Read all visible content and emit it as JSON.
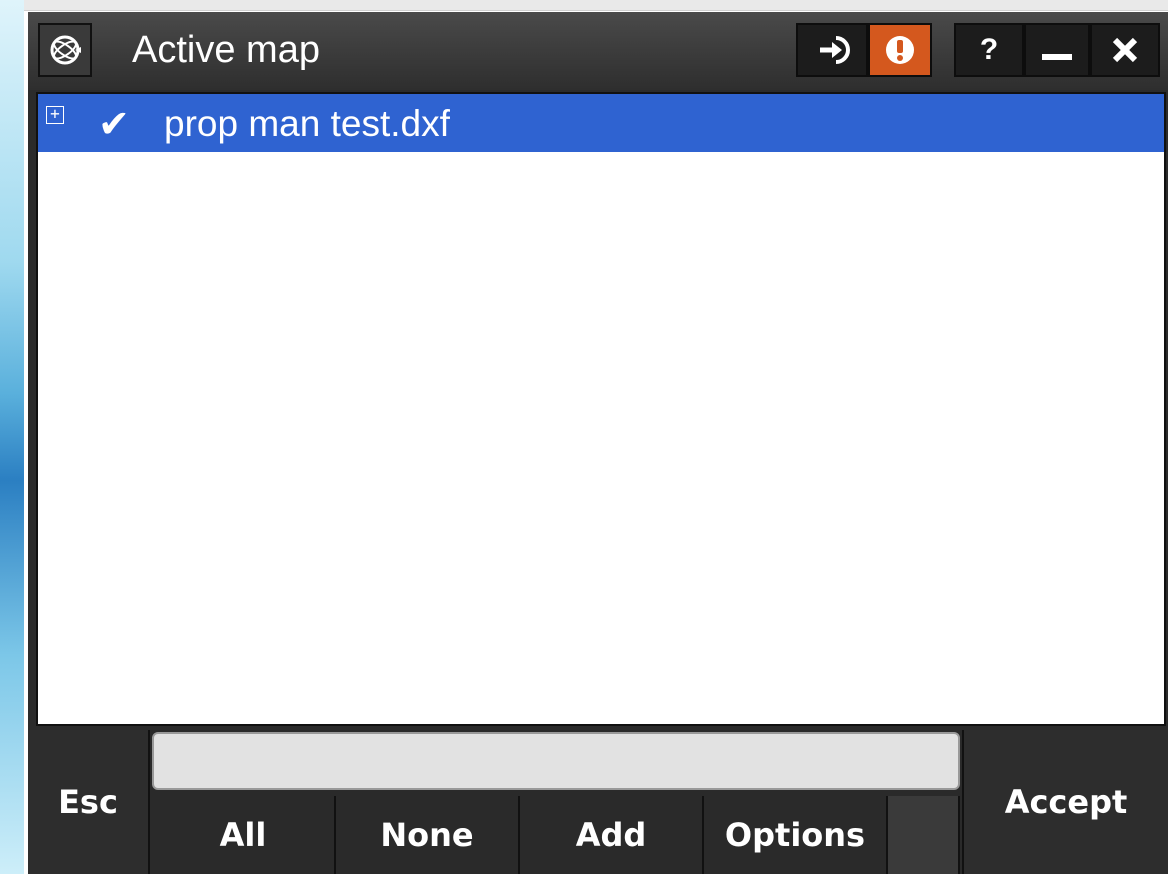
{
  "window": {
    "title": "Active map"
  },
  "titlebar": {
    "logo_icon": "trimble-globe-icon",
    "link_icon": "arrow-into-icon",
    "warning_icon": "exclamation-icon",
    "help_label": "?",
    "minimize_icon": "minimize-icon",
    "close_icon": "close-icon"
  },
  "list": {
    "items": [
      {
        "label": "prop man test.dxf",
        "checked": true,
        "expander": "+",
        "check_icon": "checkmark-icon"
      }
    ]
  },
  "bottombar": {
    "esc_label": "Esc",
    "accept_label": "Accept",
    "message": "",
    "buttons": [
      {
        "label": "All"
      },
      {
        "label": "None"
      },
      {
        "label": "Add"
      },
      {
        "label": "Options"
      }
    ]
  },
  "colors": {
    "selection": "#2f63d1",
    "warning": "#d4581e",
    "titlebar": "#3a3a3a"
  }
}
